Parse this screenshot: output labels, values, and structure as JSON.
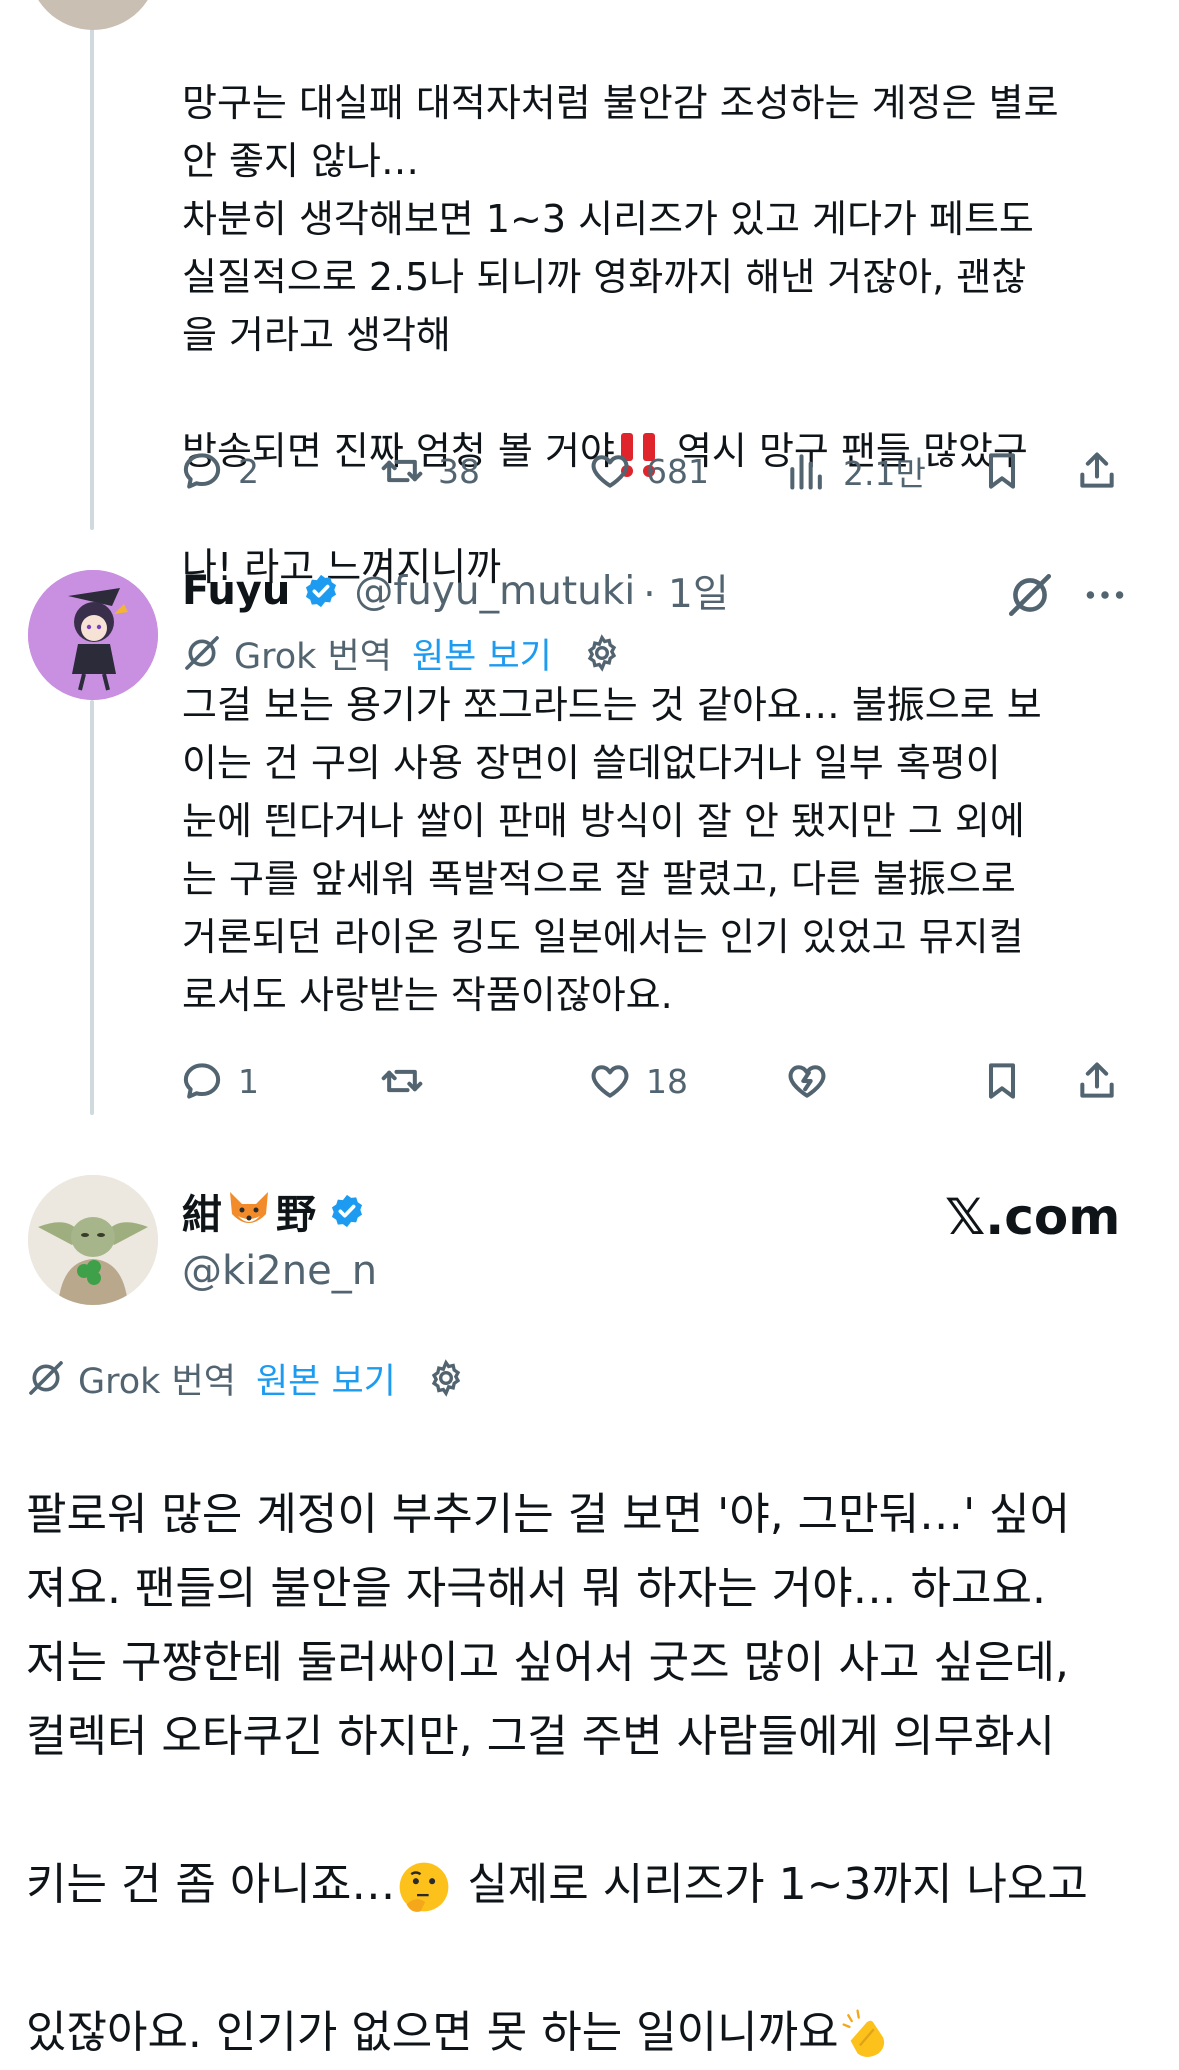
{
  "tweet1": {
    "text": "망구는 대실패 대적자처럼 불안감 조성하는 계정은 별로\n안 좋지 않나…\n차분히 생각해보면 1~3 시리즈가 있고 게다가 페트도\n실질적으로 2.5나 되니까 영화까지 해낸 거잖아, 괜찮\n을 거라고 생각해",
    "text_last_a": "방송되면 진짜 엄청 볼 거야",
    "text_last_b": " 역시 망구 팬들 많았구",
    "text_last_c": "나! 라고 느껴지니까",
    "replies": "2",
    "reposts": "38",
    "likes": "681",
    "views": "2.1만"
  },
  "tweet2": {
    "name": "Fuyu",
    "handle": "@fuyu_mutuki",
    "time": "· 1일",
    "grok_label": "Grok 번역",
    "view_original": "원본 보기",
    "text": "그걸 보는 용기가 쪼그라드는 것 같아요… 불振으로 보\n이는 건 구의 사용 장면이 쓸데없다거나 일부 혹평이\n눈에 띈다거나 쌀이 판매 방식이 잘 안 됐지만 그 외에\n는 구를 앞세워 폭발적으로 잘 팔렸고, 다른 불振으로\n거론되던 라이온 킹도 일본에서는 인기 있었고 뮤지컬\n로서도 사랑받는 작품이잖아요.",
    "replies": "1",
    "likes": "18"
  },
  "tweet3": {
    "name_a": "紺",
    "name_b": "野",
    "handle": "@ki2ne_n",
    "brand": "𝕏.com",
    "grok_label": "Grok 번역",
    "view_original": "원본 보기",
    "text": "팔로워 많은 계정이 부추기는 걸 보면 '야, 그만둬…' 싶어\n져요. 팬들의 불안을 자극해서 뭐 하자는 거야… 하고요.\n저는 구쨩한테 둘러싸이고 싶어서 굿즈 많이 사고 싶은데,\n컬렉터 오타쿠긴 하지만, 그걸 주변 사람들에게 의무화시",
    "text_line5": "키는 건 좀 아니죠…",
    "text_line5b": " 실제로 시리즈가 1~3까지 나오고",
    "text_line6": "있잖아요. 인기가 없으면 못 하는 일이니까요"
  },
  "icons": [
    "reply-icon",
    "repost-icon",
    "like-icon",
    "views-icon",
    "bookmark-icon",
    "share-icon",
    "verified-icon",
    "grok-icon",
    "gear-icon",
    "more-icon",
    "heartbreak-icon"
  ],
  "colors": {
    "accent": "#1d9bf0",
    "secondary_text": "#536471",
    "thread_line": "#cfd9de"
  }
}
